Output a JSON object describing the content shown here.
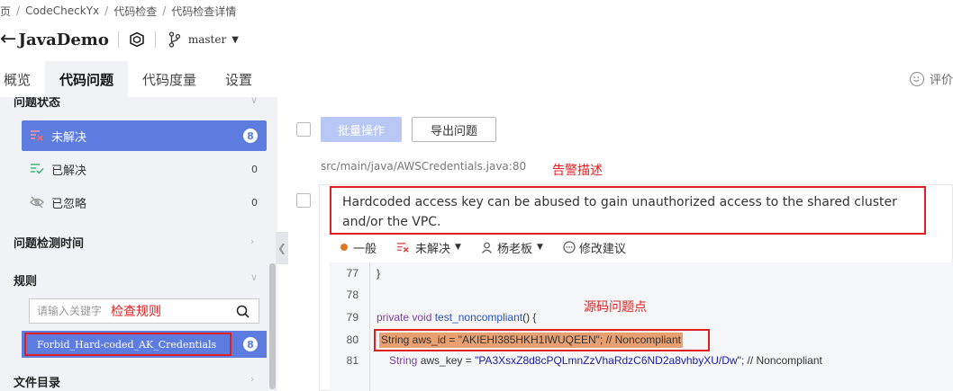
{
  "breadcrumb": [
    "页",
    "CodeCheckYx",
    "代码检查",
    "代码检查详情"
  ],
  "project": {
    "title": "JavaDemo",
    "branch": "master"
  },
  "tabs": [
    "概览",
    "代码问题",
    "代码度量",
    "设置"
  ],
  "rating_label": "评价",
  "sidebar": {
    "status_section_title": "问题状态",
    "status_items": [
      {
        "label": "未解决",
        "count": "8"
      },
      {
        "label": "已解决",
        "count": "0"
      },
      {
        "label": "已忽略",
        "count": "0"
      }
    ],
    "detect_time_title": "问题检测时间",
    "rules_title": "规则",
    "search_placeholder": "请输入关键字",
    "search_annotation": "检查规则",
    "rule_item": {
      "label": "Forbid_Hard-coded_AK_Credentials",
      "count": "8"
    },
    "file_dir_title": "文件目录"
  },
  "toolbar": {
    "batch_label": "批量操作",
    "export_label": "导出问题"
  },
  "issue": {
    "file_path": "src/main/java/AWSCredentials.java:80",
    "desc_annotation": "告警描述",
    "description": "Hardcoded access key can be abused to gain unauthorized access to the shared cluster and/or the VPC.",
    "severity": "一般",
    "status": "未解决",
    "assignee": "杨老板",
    "suggest": "修改建议",
    "src_annotation": "源码问题点",
    "code_lines": [
      {
        "num": "77",
        "text": "}"
      },
      {
        "num": "78",
        "text": ""
      },
      {
        "num": "79",
        "kw": "private void ",
        "fn": "test_noncompliant",
        "rest": "() {"
      },
      {
        "num": "80",
        "text": "String aws_id = \"AKIEHI385HKH1IWUQEEN\"; // Noncompliant"
      },
      {
        "num": "81",
        "kw": "String ",
        "rest1": "aws_key = ",
        "str": "\"PA3XsxZ8d8cPQLmnZzVhaRdzC6ND2a8vhbyXU/Dw\"",
        "rest2": "; // Noncompliant"
      }
    ]
  },
  "colors": {
    "accent": "#5c7ce0",
    "annotation": "#e02020",
    "highlight": "#e8a070"
  }
}
